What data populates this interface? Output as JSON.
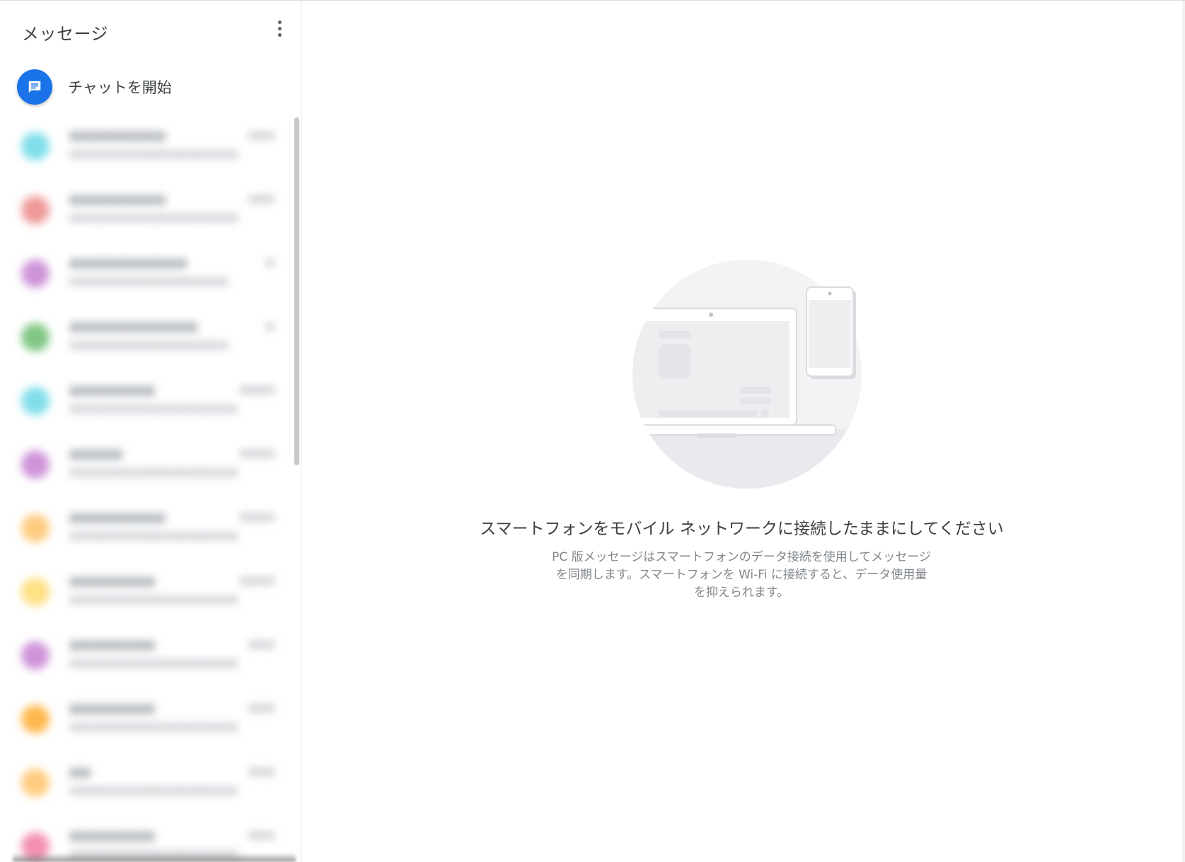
{
  "sidebar": {
    "title": "メッセージ",
    "menu_icon": "more-vert-icon",
    "start_chat": {
      "label": "チャットを開始",
      "icon": "chat-icon",
      "fab_color": "#1a73e8"
    },
    "conversations": [
      {
        "name": "■■■■■■■■■",
        "time": "■■■",
        "snippet": "■■■■■■■■■■■■■■■■■■■",
        "avatar_color": "#80deea"
      },
      {
        "name": "■■■■■■■■■",
        "time": "■■■",
        "snippet": "■■■■■■■■■■■■■■■■■■■",
        "avatar_color": "#ef9a9a"
      },
      {
        "name": "■■■■■■■■■■■",
        "time": "■",
        "snippet": "■■■■■■■■■■■■■■■■■",
        "avatar_color": "#ce93d8"
      },
      {
        "name": "■■■■■■■■■■■■",
        "time": "■",
        "snippet": "■■■■■■■■■■■■■■■■■",
        "avatar_color": "#81c784"
      },
      {
        "name": "■■■■■■■■",
        "time": "■■■■",
        "snippet": "■■■■■■■■■■■■■■■■■■",
        "avatar_color": "#80deea"
      },
      {
        "name": "■■■■■",
        "time": "■■■■",
        "snippet": "■■■■■■■■■■■■■■■■■■■",
        "avatar_color": "#ce93d8"
      },
      {
        "name": "■■■■■■■■■",
        "time": "■■■■",
        "snippet": "■■■■■■■■■■■■■■■■■■■",
        "avatar_color": "#ffcc80"
      },
      {
        "name": "■■■■■■■■",
        "time": "■■■■",
        "snippet": "■■■■■■■■■■■■■■■■■■■",
        "avatar_color": "#ffe082"
      },
      {
        "name": "■■■■■■■■",
        "time": "■■■",
        "snippet": "■■■■■■■■■■■■■■■■■■■",
        "avatar_color": "#ce93d8"
      },
      {
        "name": "■■■■■■■■",
        "time": "■■■",
        "snippet": "■■■■■■■■■■■■■■■■■■■",
        "avatar_color": "#ffb74d"
      },
      {
        "name": "■■",
        "time": "■■■",
        "snippet": "■■■■■■■■■■■■■■■■■■",
        "avatar_color": "#ffcc80"
      },
      {
        "name": "■■■■■■■■",
        "time": "■■■",
        "snippet": "■■■■■■■■■■■■■■■■■■■",
        "avatar_color": "#f48fb1"
      }
    ]
  },
  "main": {
    "illustration_icon": "laptop-phone-illustration-icon",
    "title": "スマートフォンをモバイル ネットワークに接続したままにしてください",
    "description": "PC 版メッセージはスマートフォンのデータ接続を使用してメッセージを同期します。スマートフォンを Wi-Fi に接続すると、データ使用量を抑えられます。"
  },
  "colors": {
    "accent": "#1a73e8",
    "text_primary": "#3c4043",
    "text_secondary": "#80868b"
  }
}
